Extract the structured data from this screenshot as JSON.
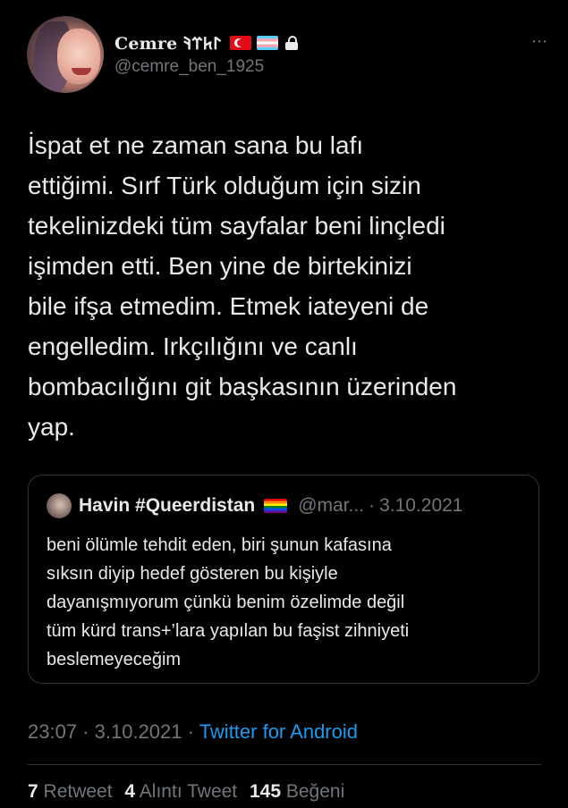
{
  "author": {
    "display_name": "Cemre 𐰃𐱅𐰼𐰚",
    "handle": "@cemre_ben_1925",
    "badges": [
      "turkey-flag-icon",
      "trans-flag-icon",
      "lock-icon"
    ]
  },
  "more_icon": "⋯",
  "tweet": {
    "text": "İspat et ne zaman sana bu lafı\nettiğimi. Sırf Türk olduğum için sizin\ntekelinizdeki tüm sayfalar beni linçledi\nişimden etti. Ben yine de birtekinizi\nbile ifşa etmedim. Etmek iateyeni de\nengelledim. Irkçılığını ve canlı\nbombacılığını git başkasının üzerinden\nyap."
  },
  "quote": {
    "name": "Havin #Queerdistan",
    "handle": "@mar...",
    "dot": "·",
    "date": "3.10.2021",
    "text": "beni ölümle tehdit eden, biri şunun kafasına\nsıksın diyip hedef gösteren bu kişiyle\ndayanışmıyorum çünkü benim özelimde değil\ntüm kürd trans+’lara yapılan bu faşist zihniyeti\nbeslemeyeceğim"
  },
  "meta": {
    "time": "23:07",
    "dot": "·",
    "date": "3.10.2021",
    "dot2": "·",
    "source": "Twitter for Android"
  },
  "stats": {
    "retweets_count": "7",
    "retweets_label": "Retweet",
    "quotes_count": "4",
    "quotes_label": "Alıntı Tweet",
    "likes_count": "145",
    "likes_label": "Beğeni"
  },
  "colors": {
    "background": "#000000",
    "text": "#e7e9ea",
    "secondary": "#71767b",
    "link": "#1d9bf0",
    "border": "#2f3336"
  }
}
